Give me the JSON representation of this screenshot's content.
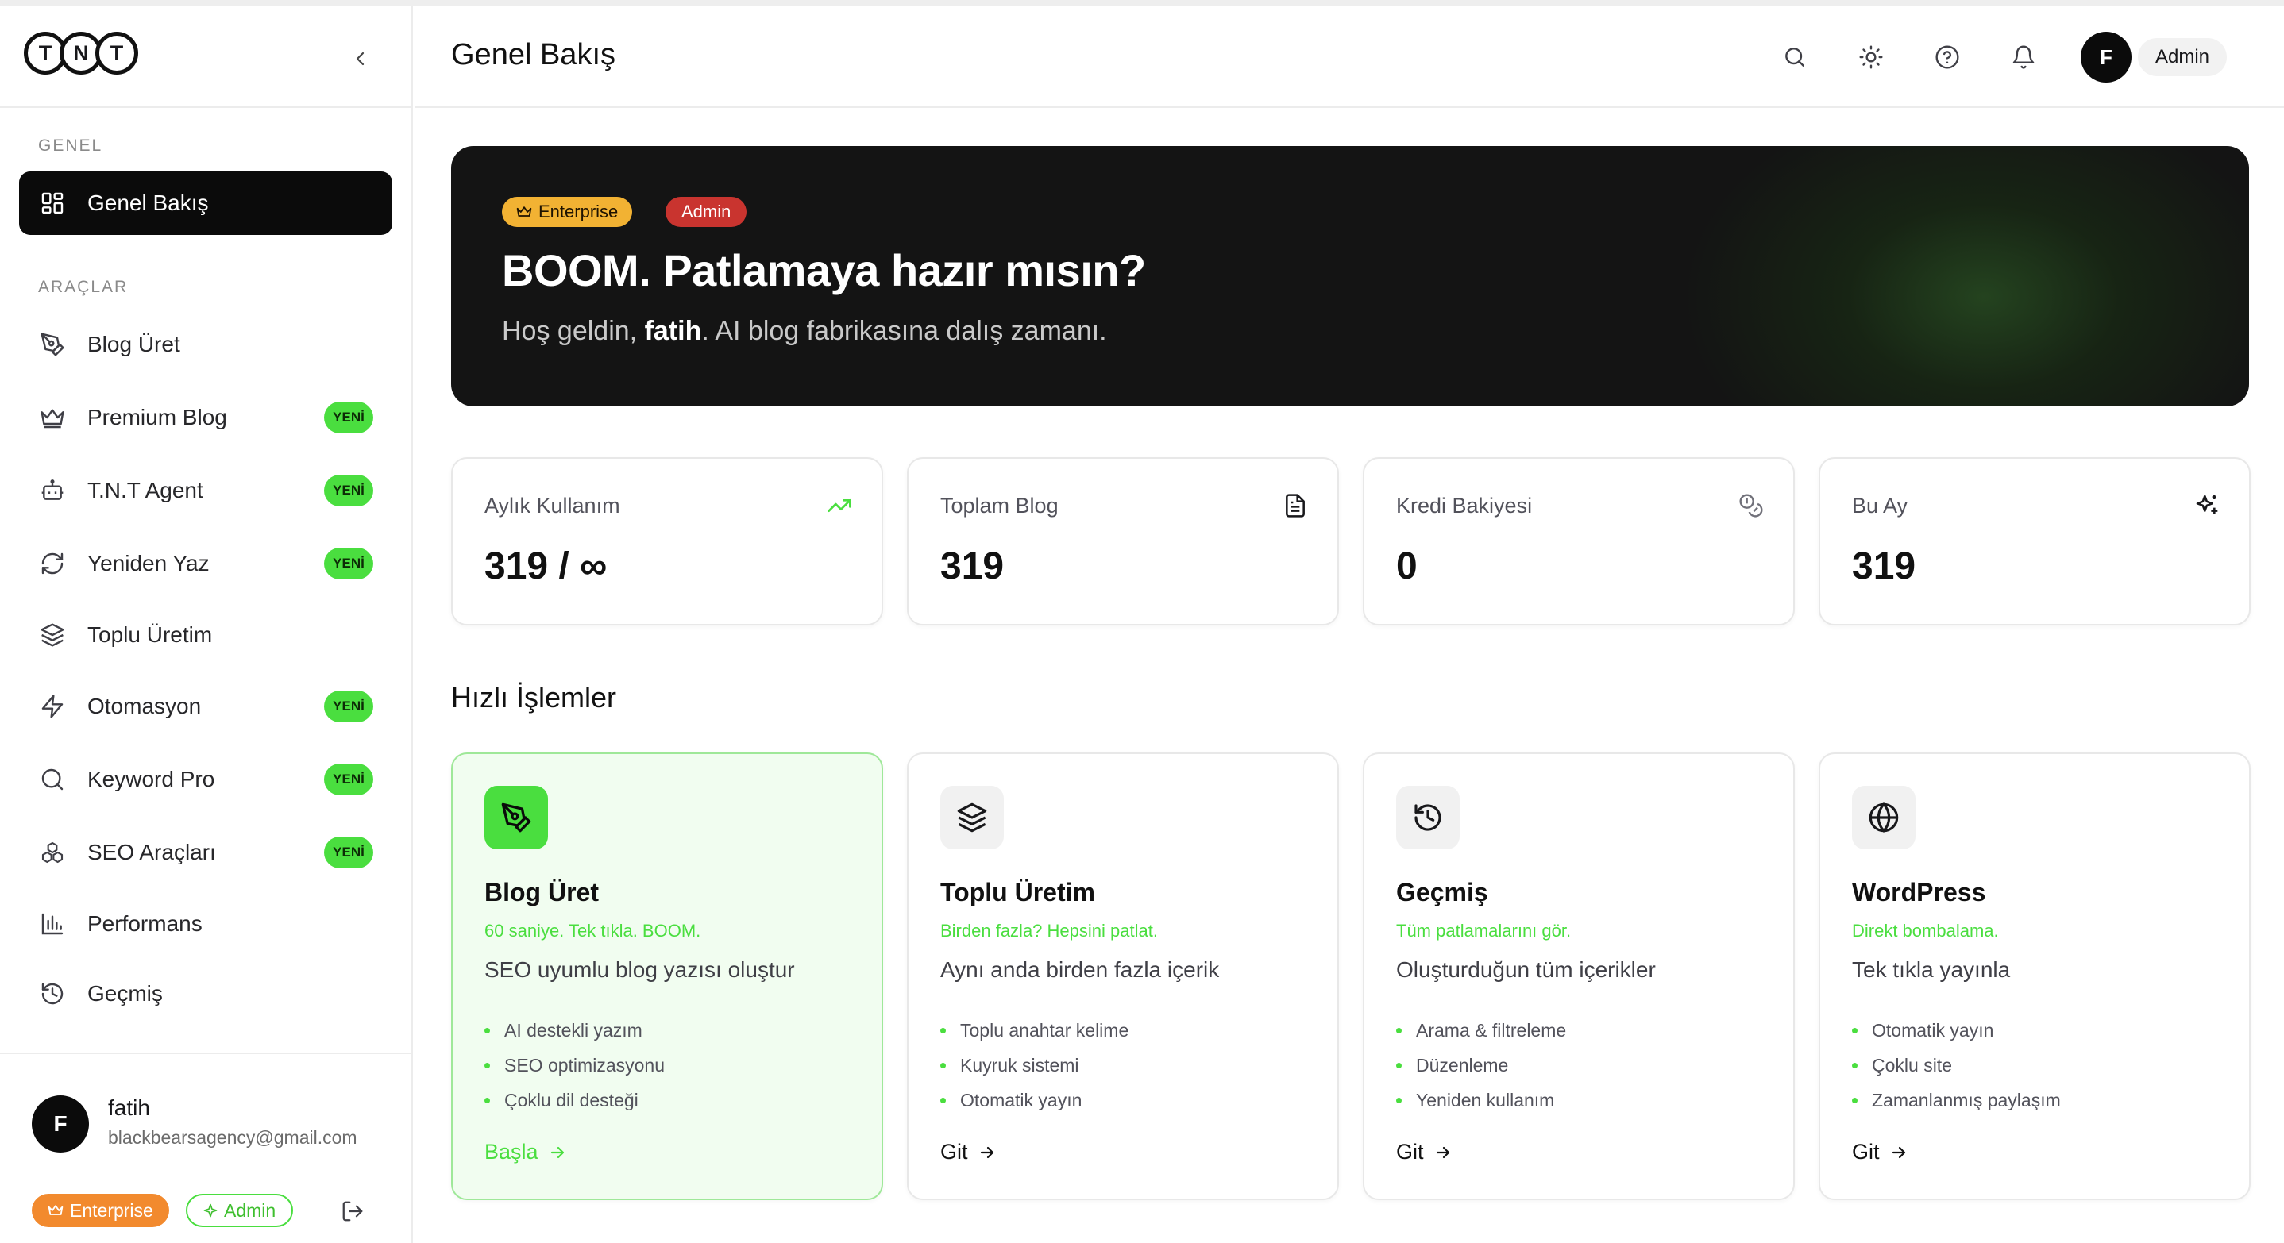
{
  "brand": {
    "logo_letters": [
      "T",
      "N",
      "T"
    ]
  },
  "sidebar": {
    "sections": {
      "general": "GENEL",
      "tools": "ARAÇLAR"
    },
    "active_item": {
      "label": "Genel Bakış",
      "icon": "dashboard-icon"
    },
    "items": [
      {
        "label": "Blog Üret",
        "icon": "pen-tool-icon",
        "badge": ""
      },
      {
        "label": "Premium Blog",
        "icon": "crown-icon",
        "badge": "YENİ"
      },
      {
        "label": "T.N.T Agent",
        "icon": "bot-icon",
        "badge": "YENİ"
      },
      {
        "label": "Yeniden Yaz",
        "icon": "refresh-icon",
        "badge": "YENİ"
      },
      {
        "label": "Toplu Üretim",
        "icon": "layers-icon",
        "badge": ""
      },
      {
        "label": "Otomasyon",
        "icon": "zap-icon",
        "badge": "YENİ"
      },
      {
        "label": "Keyword Pro",
        "icon": "search-icon",
        "badge": "YENİ"
      },
      {
        "label": "SEO Araçları",
        "icon": "cubes-icon",
        "badge": "YENİ"
      },
      {
        "label": "Performans",
        "icon": "bar-chart-icon",
        "badge": ""
      },
      {
        "label": "Geçmiş",
        "icon": "history-icon",
        "badge": ""
      }
    ],
    "user": {
      "initial": "F",
      "name": "fatih",
      "email": "blackbearsagency@gmail.com",
      "plan": "Enterprise",
      "role": "Admin"
    }
  },
  "header": {
    "title": "Genel Bakış",
    "avatar_initial": "F",
    "role": "Admin",
    "icons": [
      "search-icon",
      "sun-icon",
      "help-icon",
      "bell-icon"
    ]
  },
  "hero": {
    "badges": {
      "plan": "Enterprise",
      "role": "Admin"
    },
    "title": "BOOM. Patlamaya hazır mısın?",
    "greeting": "Hoş geldin,",
    "username": "fatih",
    "tagline": ". AI blog fabrikasına dalış zamanı."
  },
  "stats": [
    {
      "label": "Aylık Kullanım",
      "value": "319 / ∞",
      "icon": "trending-up-icon"
    },
    {
      "label": "Toplam Blog",
      "value": "319",
      "icon": "file-text-icon"
    },
    {
      "label": "Kredi Bakiyesi",
      "value": "0",
      "icon": "coins-icon"
    },
    {
      "label": "Bu Ay",
      "value": "319",
      "icon": "sparkles-icon"
    }
  ],
  "quick_actions": {
    "title": "Hızlı İşlemler",
    "cards": [
      {
        "title": "Blog Üret",
        "tag": "60 saniye. Tek tıkla. BOOM.",
        "description": "SEO uyumlu blog yazısı oluştur",
        "features": [
          "AI destekli yazım",
          "SEO optimizasyonu",
          "Çoklu dil desteği"
        ],
        "cta": "Başla",
        "icon": "pen-tool-icon"
      },
      {
        "title": "Toplu Üretim",
        "tag": "Birden fazla? Hepsini patlat.",
        "description": "Aynı anda birden fazla içerik",
        "features": [
          "Toplu anahtar kelime",
          "Kuyruk sistemi",
          "Otomatik yayın"
        ],
        "cta": "Git",
        "icon": "layers-icon"
      },
      {
        "title": "Geçmiş",
        "tag": "Tüm patlamalarını gör.",
        "description": "Oluşturduğun tüm içerikler",
        "features": [
          "Arama & filtreleme",
          "Düzenleme",
          "Yeniden kullanım"
        ],
        "cta": "Git",
        "icon": "history-icon"
      },
      {
        "title": "WordPress",
        "tag": "Direkt bombalama.",
        "description": "Tek tıkla yayınla",
        "features": [
          "Otomatik yayın",
          "Çoklu site",
          "Zamanlanmış paylaşım"
        ],
        "cta": "Git",
        "icon": "globe-icon"
      }
    ]
  },
  "colors": {
    "accent_green": "#4ade3f",
    "dark": "#0b0b0b",
    "enterprise_orange": "#f28a2e",
    "admin_red": "#c9342f",
    "enterprise_gold": "#f2b233"
  }
}
